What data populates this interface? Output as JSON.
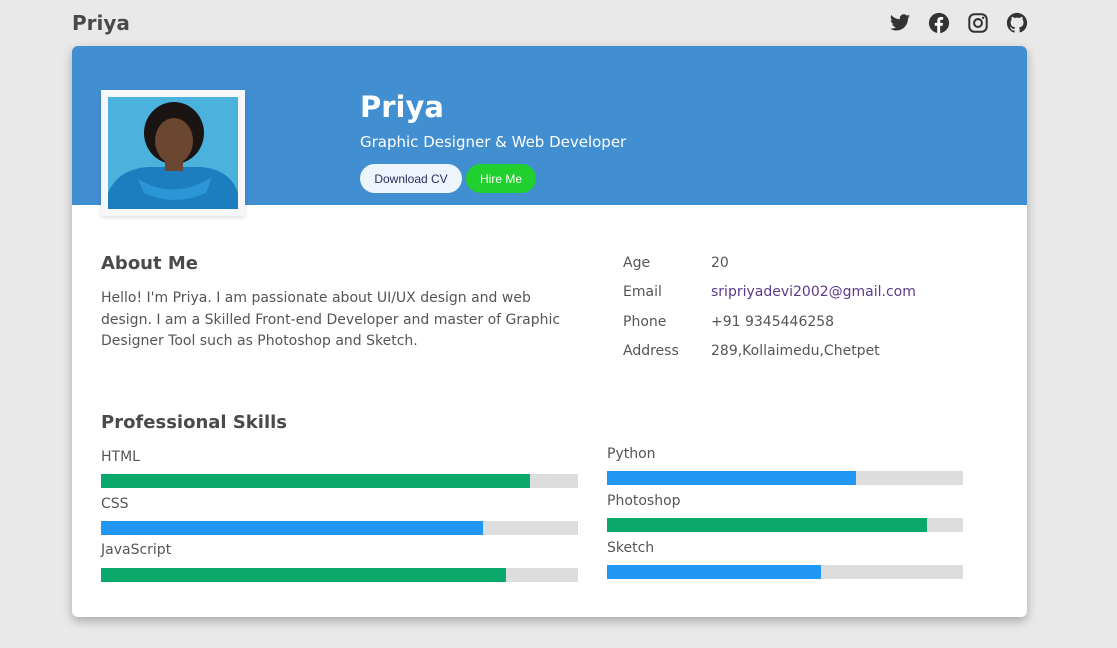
{
  "header": {
    "brand": "Priya"
  },
  "social": [
    "twitter-icon",
    "facebook-icon",
    "instagram-icon",
    "github-icon"
  ],
  "profile": {
    "name": "Priya",
    "role": "Graphic Designer & Web Developer",
    "download_label": "Download CV",
    "hire_label": "Hire Me"
  },
  "about": {
    "title": "About Me",
    "text": "Hello! I'm Priya. I am passionate about UI/UX design and web design. I am a Skilled Front-end Developer and master of Graphic Designer Tool such as Photoshop and Sketch."
  },
  "info": [
    {
      "key": "Age",
      "value": "20"
    },
    {
      "key": "Email",
      "value": "sripriyadevi2002@gmail.com"
    },
    {
      "key": "Phone",
      "value": "+91 9345446258"
    },
    {
      "key": "Address",
      "value": "289,Kollaimedu,Chetpet"
    }
  ],
  "skills": {
    "title": "Professional Skills",
    "left": [
      {
        "name": "HTML",
        "level": 90,
        "color": "#0aa86b"
      },
      {
        "name": "CSS",
        "level": 80,
        "color": "#2196f3"
      },
      {
        "name": "JavaScript",
        "level": 85,
        "color": "#0aa86b"
      }
    ],
    "right": [
      {
        "name": "Python",
        "level": 70,
        "color": "#2196f3"
      },
      {
        "name": "Photoshop",
        "level": 90,
        "color": "#0aa86b"
      },
      {
        "name": "Sketch",
        "level": 60,
        "color": "#2196f3"
      }
    ]
  },
  "colors": {
    "banner": "#418fd1",
    "hire_button": "#1fd02f",
    "email_link": "#5b3a8a"
  }
}
